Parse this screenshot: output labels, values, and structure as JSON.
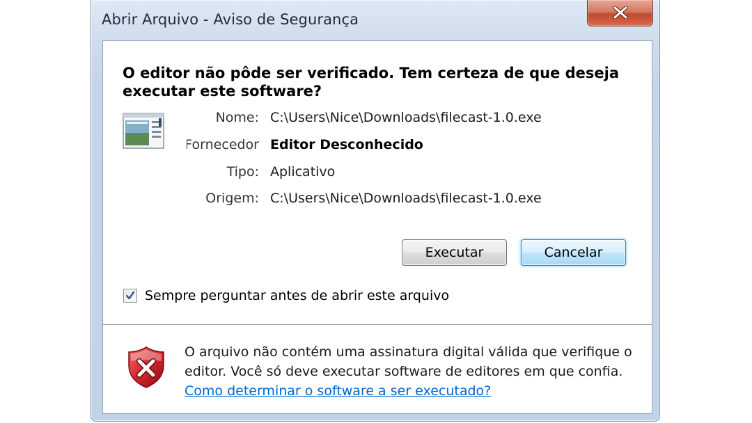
{
  "window": {
    "title": "Abrir Arquivo - Aviso de Segurança"
  },
  "dialog": {
    "headline": "O editor não pôde ser verificado. Tem certeza de que deseja executar este software?",
    "fields": [
      {
        "label": "Nome:",
        "value": "C:\\Users\\Nice\\Downloads\\filecast-1.0.exe"
      },
      {
        "label": "Fornecedor:",
        "value": "Editor Desconhecido"
      },
      {
        "label": "Tipo:",
        "value": "Aplicativo"
      },
      {
        "label": "Origem:",
        "value": "C:\\Users\\Nice\\Downloads\\filecast-1.0.exe"
      }
    ],
    "buttons": {
      "run_label": "Executar",
      "cancel_label": "Cancelar"
    },
    "checkbox": {
      "label": "Sempre perguntar antes de abrir este arquivo",
      "checked": true
    },
    "warning": {
      "text": "O arquivo não contém uma assinatura digital válida que verifique o editor. Você só deve executar software de editores em que confia.",
      "link_text": "Como determinar o software a ser executado?"
    }
  },
  "icons": {
    "close": "close-x-icon",
    "application": "application-window-icon",
    "shield": "security-shield-error-icon",
    "check": "checkmark-icon"
  },
  "colors": {
    "link": "#0066cc",
    "close_button": "#c24a30",
    "shield_red": "#c8202a",
    "default_button_border": "#3c7fb1"
  }
}
